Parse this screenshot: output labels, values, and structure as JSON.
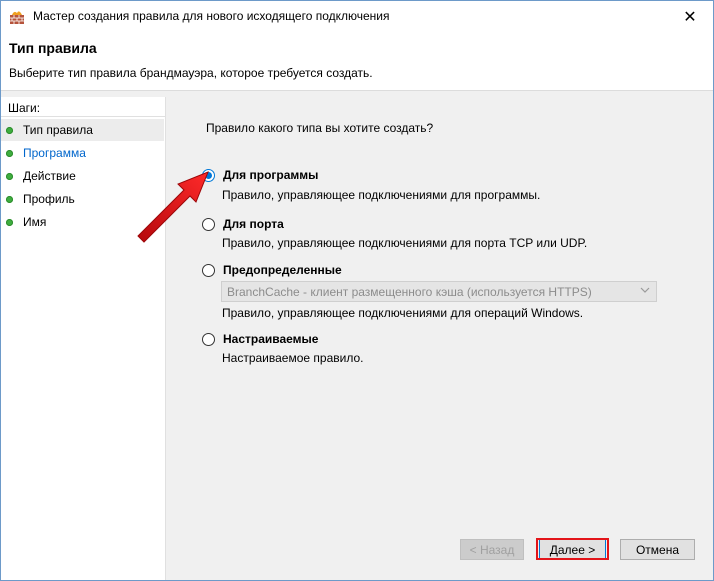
{
  "window": {
    "title": "Мастер создания правила для нового исходящего подключения",
    "close_symbol": "✕"
  },
  "header": {
    "title": "Тип правила",
    "description": "Выберите тип правила брандмауэра, которое требуется создать."
  },
  "steps": {
    "title": "Шаги:",
    "items": [
      {
        "label": "Тип правила",
        "state": "current"
      },
      {
        "label": "Программа",
        "state": "link"
      },
      {
        "label": "Действие",
        "state": "normal"
      },
      {
        "label": "Профиль",
        "state": "normal"
      },
      {
        "label": "Имя",
        "state": "normal"
      }
    ]
  },
  "content": {
    "question": "Правило какого типа вы хотите создать?",
    "options": [
      {
        "label": "Для программы",
        "description": "Правило, управляющее подключениями для программы.",
        "selected": true
      },
      {
        "label": "Для порта",
        "description": "Правило, управляющее подключениями для порта TCP или UDP.",
        "selected": false
      },
      {
        "label": "Предопределенные",
        "description": "Правило, управляющее подключениями для операций Windows.",
        "selected": false
      },
      {
        "label": "Настраиваемые",
        "description": "Настраиваемое правило.",
        "selected": false
      }
    ],
    "predefined_dropdown": {
      "value": "BranchCache - клиент размещенного кэша (используется HTTPS)",
      "enabled": false
    }
  },
  "buttons": {
    "back": "< Назад",
    "next": "Далее >",
    "cancel": "Отмена"
  },
  "colors": {
    "accent": "#0078d7",
    "annotation_red": "#e3151a",
    "step_dot": "#3fae3f",
    "link": "#0066cc"
  },
  "icons": {
    "app": "firewall-wall-icon",
    "close": "close-icon",
    "dropdown": "chevron-down-icon",
    "step": "green-dot-icon",
    "annotation": "red-arrow-icon"
  }
}
